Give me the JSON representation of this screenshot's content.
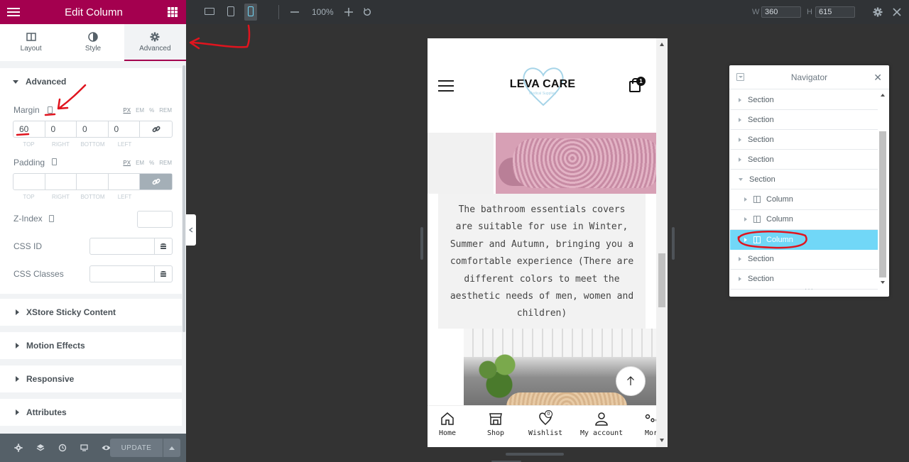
{
  "panel": {
    "title": "Edit Column",
    "tabs": [
      {
        "label": "Layout",
        "icon": "columns-icon"
      },
      {
        "label": "Style",
        "icon": "half-circle-icon"
      },
      {
        "label": "Advanced",
        "icon": "gear-icon",
        "active": true
      }
    ],
    "advanced": {
      "section_title": "Advanced",
      "margin": {
        "label": "Margin",
        "units": [
          "PX",
          "EM",
          "%",
          "REM"
        ],
        "values": {
          "top": "60",
          "right": "0",
          "bottom": "0",
          "left": "0"
        },
        "sides": [
          "TOP",
          "RIGHT",
          "BOTTOM",
          "LEFT"
        ]
      },
      "padding": {
        "label": "Padding",
        "units": [
          "PX",
          "EM",
          "%",
          "REM"
        ],
        "sides": [
          "TOP",
          "RIGHT",
          "BOTTOM",
          "LEFT"
        ]
      },
      "z_index_label": "Z-Index",
      "css_id_label": "CSS ID",
      "css_classes_label": "CSS Classes"
    },
    "sections": [
      "XStore Sticky Content",
      "Motion Effects",
      "Responsive",
      "Attributes"
    ],
    "footer": {
      "update_label": "UPDATE"
    }
  },
  "topbar": {
    "zoom": "100%",
    "width_label": "W",
    "width_value": "360",
    "height_label": "H",
    "height_value": "615"
  },
  "site": {
    "logo_text": "LEVA CARE",
    "logo_sub": "Medical Supplies",
    "cart_count": "1",
    "description": "The bathroom essentials covers are suitable for use in Winter, Summer and Autumn, bringing you a comfortable experience (There are different colors to meet the aesthetic needs of men, women and children)",
    "wishlist_count": "0",
    "bottom_nav": [
      "Home",
      "Shop",
      "Wishlist",
      "My account",
      "Mor"
    ]
  },
  "navigator": {
    "title": "Navigator",
    "rows": [
      {
        "label": "Section",
        "level": 0,
        "expanded": false
      },
      {
        "label": "Section",
        "level": 0,
        "expanded": false
      },
      {
        "label": "Section",
        "level": 0,
        "expanded": false
      },
      {
        "label": "Section",
        "level": 0,
        "expanded": false
      },
      {
        "label": "Section",
        "level": 0,
        "expanded": true
      },
      {
        "label": "Column",
        "level": 1,
        "expanded": false
      },
      {
        "label": "Column",
        "level": 1,
        "expanded": false
      },
      {
        "label": "Column",
        "level": 1,
        "expanded": false,
        "active": true
      },
      {
        "label": "Section",
        "level": 0,
        "expanded": false
      },
      {
        "label": "Section",
        "level": 0,
        "expanded": false
      }
    ]
  },
  "colors": {
    "brand": "#a4004f",
    "active_row": "#71d7f7",
    "annotation": "#e0141e"
  }
}
